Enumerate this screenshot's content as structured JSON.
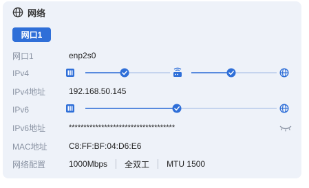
{
  "section": {
    "title": "网络",
    "icon": "globe-icon"
  },
  "tabs": [
    {
      "label": "网口1",
      "active": true
    }
  ],
  "details": {
    "interface": {
      "label": "网口1",
      "value": "enp2s0"
    },
    "ipv4": {
      "label": "IPv4",
      "path": [
        "nic-icon",
        "router-icon",
        "globe-icon"
      ],
      "status": [
        "connected",
        "connected"
      ]
    },
    "ipv4_address": {
      "label": "IPv4地址",
      "value": "192.168.50.145"
    },
    "ipv6": {
      "label": "IPv6",
      "path": [
        "nic-icon",
        "globe-icon"
      ],
      "status": [
        "connected"
      ]
    },
    "ipv6_address": {
      "label": "IPv6地址",
      "value": "************************************",
      "visibility_icon": "eye-closed-icon"
    },
    "mac": {
      "label": "MAC地址",
      "value": "C8:FF:BF:04:D6:E6"
    },
    "network_config": {
      "label": "网络配置",
      "speed": "1000Mbps",
      "duplex": "全双工",
      "mtu": "MTU 1500"
    }
  },
  "colors": {
    "accent": "#2f6fd8",
    "label": "#8a93a3",
    "card": "#eef2f9"
  }
}
